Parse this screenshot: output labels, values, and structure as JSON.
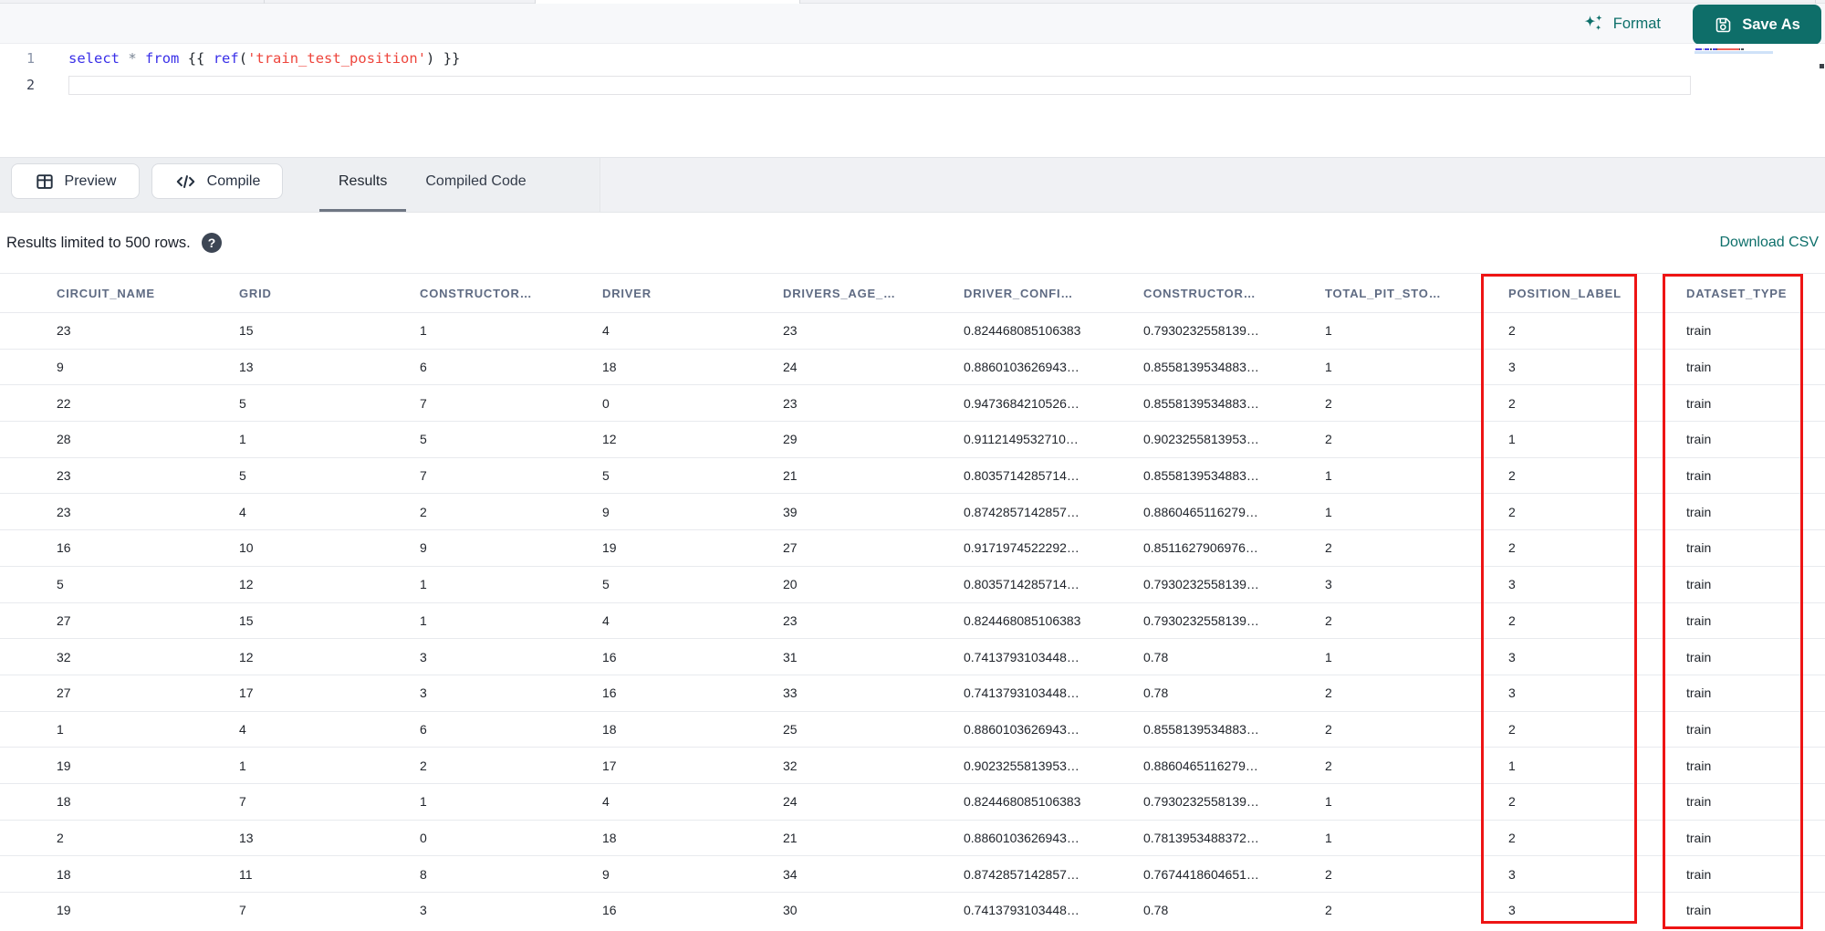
{
  "colors": {
    "teal": "#0e6e69",
    "annotation_red": "#ee1414",
    "keyword_blue": "#3a30e8",
    "string_red": "#ee463d"
  },
  "header": {
    "format_label": "Format",
    "save_as_label": "Save As"
  },
  "editor": {
    "lines": [
      {
        "number": "1",
        "tokens": [
          [
            "kw",
            "select"
          ],
          [
            "pl",
            " "
          ],
          [
            "op",
            "*"
          ],
          [
            "pl",
            " "
          ],
          [
            "kw",
            "from"
          ],
          [
            "pl",
            " "
          ],
          [
            "br",
            "{{"
          ],
          [
            "pl",
            " "
          ],
          [
            "kw",
            "ref"
          ],
          [
            "br",
            "("
          ],
          [
            "st",
            "'train_test_position'"
          ],
          [
            "br",
            ")"
          ],
          [
            "pl",
            " "
          ],
          [
            "br",
            "}}"
          ]
        ]
      },
      {
        "number": "2",
        "tokens": []
      }
    ]
  },
  "toolbar": {
    "preview_label": "Preview",
    "compile_label": "Compile",
    "tabs": [
      {
        "label": "Results",
        "active": true
      },
      {
        "label": "Compiled Code",
        "active": false
      }
    ]
  },
  "results_meta": {
    "limit_text": "Results limited to 500 rows.",
    "help_glyph": "?",
    "download_label": "Download CSV"
  },
  "table": {
    "columns": [
      "CIRCUIT_NAME",
      "GRID",
      "CONSTRUCTOR…",
      "DRIVER",
      "DRIVERS_AGE_…",
      "DRIVER_CONFI…",
      "CONSTRUCTOR…",
      "TOTAL_PIT_STO…",
      "POSITION_LABEL",
      "DATASET_TYPE"
    ],
    "rows": [
      [
        "23",
        "15",
        "1",
        "4",
        "23",
        "0.824468085106383",
        "0.7930232558139…",
        "1",
        "2",
        "train"
      ],
      [
        "9",
        "13",
        "6",
        "18",
        "24",
        "0.8860103626943…",
        "0.8558139534883…",
        "1",
        "3",
        "train"
      ],
      [
        "22",
        "5",
        "7",
        "0",
        "23",
        "0.9473684210526…",
        "0.8558139534883…",
        "2",
        "2",
        "train"
      ],
      [
        "28",
        "1",
        "5",
        "12",
        "29",
        "0.9112149532710…",
        "0.9023255813953…",
        "2",
        "1",
        "train"
      ],
      [
        "23",
        "5",
        "7",
        "5",
        "21",
        "0.8035714285714…",
        "0.8558139534883…",
        "1",
        "2",
        "train"
      ],
      [
        "23",
        "4",
        "2",
        "9",
        "39",
        "0.8742857142857…",
        "0.8860465116279…",
        "1",
        "2",
        "train"
      ],
      [
        "16",
        "10",
        "9",
        "19",
        "27",
        "0.9171974522292…",
        "0.8511627906976…",
        "2",
        "2",
        "train"
      ],
      [
        "5",
        "12",
        "1",
        "5",
        "20",
        "0.8035714285714…",
        "0.7930232558139…",
        "3",
        "3",
        "train"
      ],
      [
        "27",
        "15",
        "1",
        "4",
        "23",
        "0.824468085106383",
        "0.7930232558139…",
        "2",
        "2",
        "train"
      ],
      [
        "32",
        "12",
        "3",
        "16",
        "31",
        "0.7413793103448…",
        "0.78",
        "1",
        "3",
        "train"
      ],
      [
        "27",
        "17",
        "3",
        "16",
        "33",
        "0.7413793103448…",
        "0.78",
        "2",
        "3",
        "train"
      ],
      [
        "1",
        "4",
        "6",
        "18",
        "25",
        "0.8860103626943…",
        "0.8558139534883…",
        "2",
        "2",
        "train"
      ],
      [
        "19",
        "1",
        "2",
        "17",
        "32",
        "0.9023255813953…",
        "0.8860465116279…",
        "2",
        "1",
        "train"
      ],
      [
        "18",
        "7",
        "1",
        "4",
        "24",
        "0.824468085106383",
        "0.7930232558139…",
        "1",
        "2",
        "train"
      ],
      [
        "2",
        "13",
        "0",
        "18",
        "21",
        "0.8860103626943…",
        "0.7813953488372…",
        "1",
        "2",
        "train"
      ],
      [
        "18",
        "11",
        "8",
        "9",
        "34",
        "0.8742857142857…",
        "0.7674418604651…",
        "2",
        "3",
        "train"
      ],
      [
        "19",
        "7",
        "3",
        "16",
        "30",
        "0.7413793103448…",
        "0.78",
        "2",
        "3",
        "train"
      ]
    ]
  },
  "annotations": {
    "highlighted_columns": [
      "POSITION_LABEL",
      "DATASET_TYPE"
    ]
  }
}
